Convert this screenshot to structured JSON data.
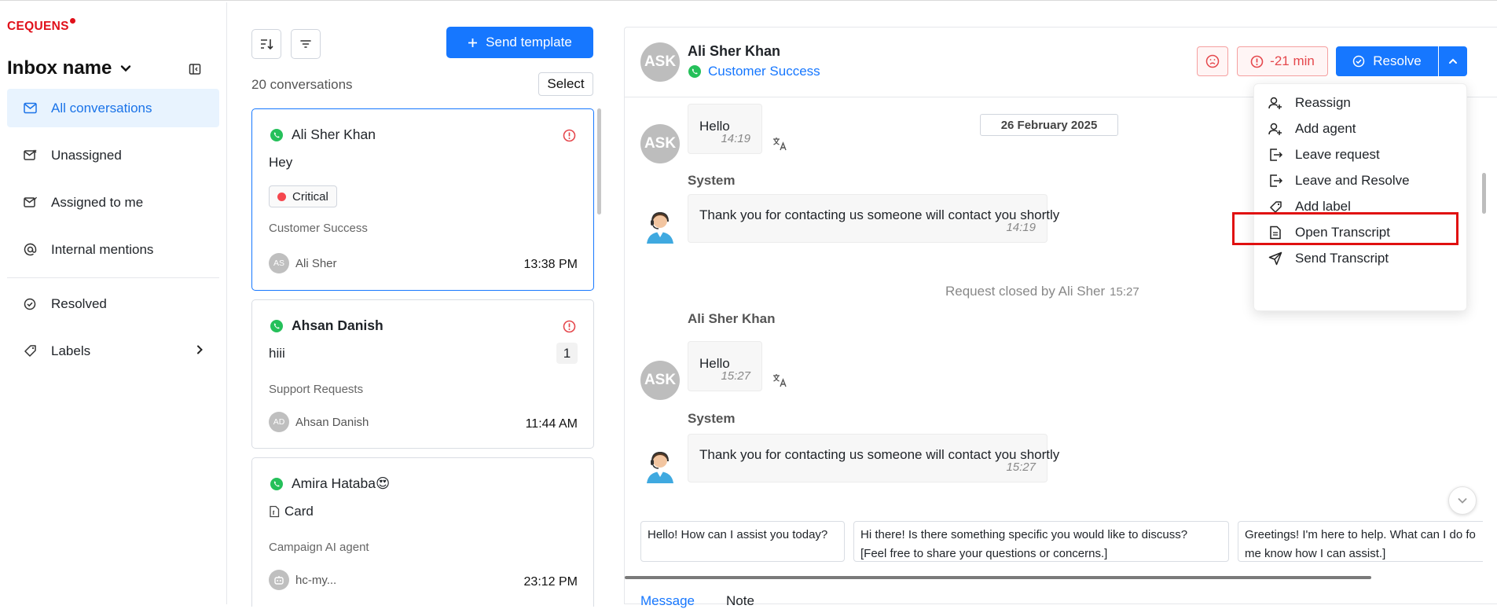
{
  "brand": {
    "logo_text": "CEQUENS",
    "accent": "#1677ff",
    "brand_red": "#e0101a"
  },
  "sidebar": {
    "inbox_name": "Inbox name",
    "items": [
      {
        "label": "All conversations",
        "icon": "inbox-icon",
        "active": true
      },
      {
        "label": "Unassigned",
        "icon": "mail-unassigned-icon"
      },
      {
        "label": "Assigned to me",
        "icon": "mail-assigned-icon"
      },
      {
        "label": "Internal mentions",
        "icon": "at-icon"
      },
      {
        "label": "Resolved",
        "icon": "check-circle-icon"
      },
      {
        "label": "Labels",
        "icon": "tag-icon"
      }
    ]
  },
  "list": {
    "send_template_label": "Send template",
    "count_label": "20 conversations",
    "select_label": "Select",
    "cards": [
      {
        "name": "Ali Sher Khan",
        "message": "Hey",
        "badge": "Critical",
        "team": "Customer Success",
        "agent_initials": "AS",
        "agent": "Ali Sher",
        "time": "13:38 PM"
      },
      {
        "name": "Ahsan Danish",
        "message": "hiii",
        "unread": "1",
        "team": "Support Requests",
        "agent_initials": "AD",
        "agent": "Ahsan Danish",
        "time": "11:44 AM"
      },
      {
        "name": "Amira Hataba",
        "emoji": "😍",
        "message": "Card",
        "team": "Campaign AI agent",
        "agent": "hc-my...",
        "time": "23:12 PM"
      }
    ]
  },
  "chat": {
    "contact_initials": "ASK",
    "contact_name": "Ali Sher Khan",
    "team": "Customer Success",
    "sla": "-21 min",
    "resolve_label": "Resolve",
    "date_chip": "26 February 2025",
    "messages": [
      {
        "text": "Hello",
        "time": "14:19"
      },
      {
        "sender": "System",
        "text": "Thank you for contacting us someone will contact you shortly",
        "time": "14:19"
      },
      {
        "note": "Request closed by Ali Sher",
        "time": "15:27"
      },
      {
        "sender": "Ali Sher Khan",
        "text": "Hello",
        "time": "15:27"
      },
      {
        "sender": "System",
        "text": "Thank you for contacting us someone will contact you shortly",
        "time": "15:27"
      }
    ],
    "suggestions": [
      {
        "line1": "Hello! How can I assist you today?",
        "line2": ""
      },
      {
        "line1": "Hi there! Is there something specific you would like to discuss?",
        "line2": "[Feel free to share your questions or concerns.]"
      },
      {
        "line1": "Greetings! I'm here to help. What can I do fo",
        "line2": "me know how I can assist.]"
      }
    ],
    "tabs": {
      "message": "Message",
      "note": "Note"
    }
  },
  "menu": {
    "items": [
      {
        "label": "Reassign",
        "icon": "user-plus-icon"
      },
      {
        "label": "Add agent",
        "icon": "user-add-icon"
      },
      {
        "label": "Leave request",
        "icon": "exit-icon"
      },
      {
        "label": "Leave and Resolve",
        "icon": "exit-resolve-icon"
      },
      {
        "label": "Add label",
        "icon": "tag-icon",
        "highlighted": true
      },
      {
        "label": "Open Transcript",
        "icon": "document-icon"
      },
      {
        "label": "Send Transcript",
        "icon": "send-icon"
      }
    ]
  }
}
